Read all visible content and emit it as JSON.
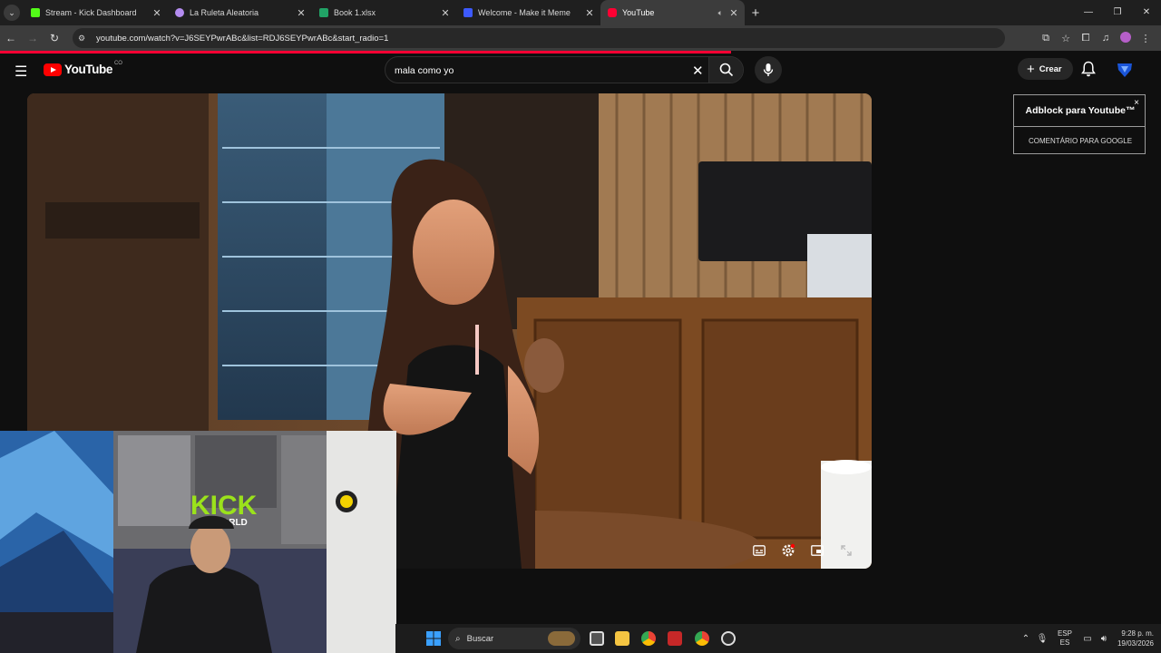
{
  "browser": {
    "tabs": [
      {
        "title": "Stream - Kick Dashboard",
        "favicon_color": "#53fc18",
        "active": false
      },
      {
        "title": "La Ruleta Aleatoria",
        "favicon_color": "#b48cf0",
        "active": false
      },
      {
        "title": "Book 1.xlsx",
        "favicon_color": "#21a366",
        "active": false
      },
      {
        "title": "Welcome - Make it Meme",
        "favicon_color": "#3d5afe",
        "active": false
      },
      {
        "title": "YouTube",
        "favicon_color": "#ff0033",
        "active": true
      }
    ],
    "url": "youtube.com/watch?v=J6SEYPwrABc&list=RDJ6SEYPwrABc&start_radio=1",
    "load_progress": 0.63
  },
  "youtube": {
    "logo_text": "YouTube",
    "country_code": "CO",
    "search_value": "mala como yo",
    "create_label": "Crear",
    "accent_color": "#ff0000"
  },
  "adblock_popup": {
    "title": "Adblock para Youtube™",
    "subtitle": "COMENTÁRIO PARA GOOGLE",
    "close_label": "×"
  },
  "webcam": {
    "wall_text": "KICK",
    "wall_text_small": "WORLD"
  },
  "taskbar": {
    "search_label": "Buscar",
    "language_line1": "ESP",
    "language_line2": "ES",
    "time": "9:28 p. m.",
    "date": "19/03/2026"
  }
}
